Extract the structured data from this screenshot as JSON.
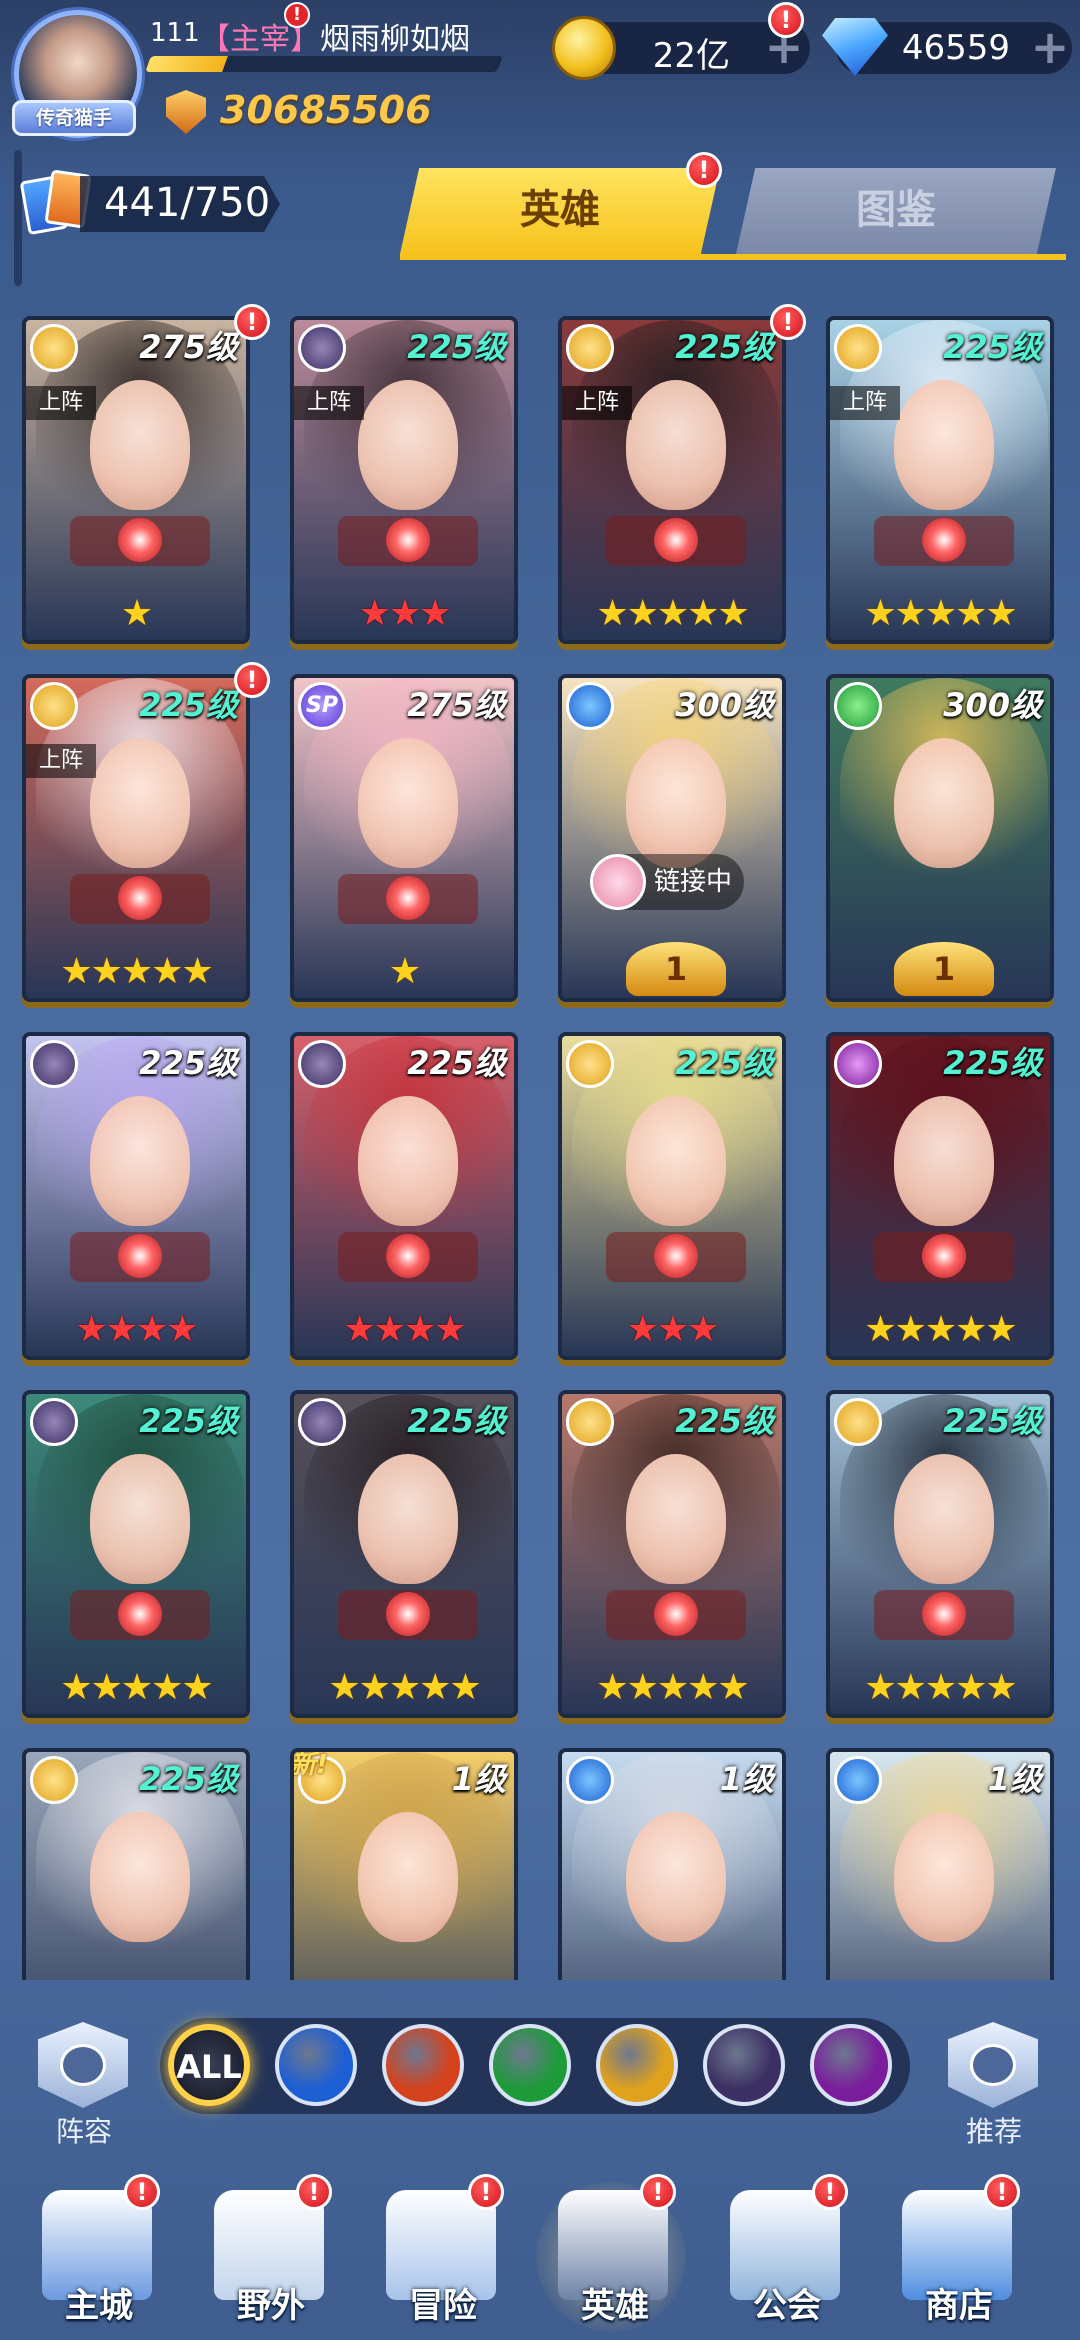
{
  "player": {
    "level": "111",
    "name_tag": "【主宰】",
    "name": "烟雨柳如烟",
    "title_badge": "传奇猫手",
    "power": "30685506",
    "exp_fraction": 0.22
  },
  "currencies": {
    "gold": "22亿",
    "gems": "46559",
    "plus_symbol": "+",
    "alert": "!"
  },
  "roster": {
    "count": "441/750"
  },
  "tabs": {
    "hero": "英雄",
    "atlas": "图鉴"
  },
  "labels": {
    "on_team": "上阵",
    "linking": "链接中",
    "new": "新!"
  },
  "heroes": [
    {
      "element": "light",
      "level": "275级",
      "level_color": "white",
      "on_team": true,
      "stars": "★",
      "star_style": "gold-wing",
      "alert": true,
      "hair": "#2c2422"
    },
    {
      "element": "dark",
      "level": "225级",
      "level_color": "teal",
      "on_team": true,
      "stars": "★★★",
      "star_style": "red",
      "alert": false,
      "hair": "#3a2b32"
    },
    {
      "element": "light",
      "level": "225级",
      "level_color": "teal",
      "on_team": true,
      "stars": "★★★★★",
      "star_style": "gold",
      "alert": true,
      "hair": "#1f1c1e"
    },
    {
      "element": "light",
      "level": "225级",
      "level_color": "teal",
      "on_team": true,
      "stars": "★★★★★",
      "star_style": "gold",
      "alert": false,
      "hair": "#e6f0fb"
    },
    {
      "element": "light",
      "level": "225级",
      "level_color": "teal",
      "on_team": true,
      "stars": "★★★★★",
      "star_style": "gold",
      "alert": true,
      "hair": "#efe9f1"
    },
    {
      "element": "sp",
      "element_text": "SP",
      "level": "275级",
      "level_color": "white",
      "on_team": false,
      "stars": "★",
      "star_style": "gold-wing",
      "alert": false,
      "hair": "#f4b6c4"
    },
    {
      "element": "water",
      "level": "300级",
      "level_color": "white",
      "on_team": false,
      "rank": "1",
      "linking": true,
      "alert": false,
      "hair": "#f5d37a"
    },
    {
      "element": "wind",
      "level": "300级",
      "level_color": "white",
      "on_team": false,
      "rank": "1",
      "alert": false,
      "hair": "#e8c25a"
    },
    {
      "element": "dark",
      "level": "225级",
      "level_color": "white",
      "on_team": false,
      "stars": "★★★★",
      "star_style": "red",
      "alert": false,
      "hair": "#b7a6ee"
    },
    {
      "element": "dark",
      "level": "225级",
      "level_color": "white",
      "on_team": false,
      "stars": "★★★★",
      "star_style": "red",
      "alert": false,
      "hair": "#c4303a"
    },
    {
      "element": "light",
      "level": "225级",
      "level_color": "teal",
      "on_team": false,
      "stars": "★★★",
      "star_style": "red",
      "alert": false,
      "hair": "#e6dc8c"
    },
    {
      "element": "chaos",
      "level": "225级",
      "level_color": "teal",
      "on_team": false,
      "stars": "★★★★★",
      "star_style": "gold",
      "alert": false,
      "hair": "#5a0f1a"
    },
    {
      "element": "dark",
      "level": "225级",
      "level_color": "teal",
      "on_team": false,
      "stars": "★★★★★",
      "star_style": "gold",
      "alert": false,
      "hair": "#1e4a3a"
    },
    {
      "element": "dark",
      "level": "225级",
      "level_color": "teal",
      "on_team": false,
      "stars": "★★★★★",
      "star_style": "gold",
      "alert": false,
      "hair": "#241c20"
    },
    {
      "element": "light",
      "level": "225级",
      "level_color": "teal",
      "on_team": false,
      "stars": "★★★★★",
      "star_style": "gold",
      "alert": false,
      "hair": "#3a2420"
    },
    {
      "element": "light",
      "level": "225级",
      "level_color": "teal",
      "on_team": false,
      "stars": "★★★★★",
      "star_style": "gold",
      "alert": false,
      "hair": "#1c2430"
    },
    {
      "element": "light",
      "level": "225级",
      "level_color": "teal",
      "on_team": false,
      "alert": false,
      "hair": "#e8e8ee"
    },
    {
      "element": "light",
      "level": "1级",
      "level_color": "white",
      "on_team": false,
      "is_new": true,
      "alert": false,
      "hair": "#d0a24a"
    },
    {
      "element": "water",
      "level": "1级",
      "level_color": "white",
      "on_team": false,
      "alert": false,
      "hair": "#d8dde8"
    },
    {
      "element": "water",
      "level": "1级",
      "level_color": "white",
      "on_team": false,
      "alert": false,
      "hair": "#f0d896"
    }
  ],
  "filters": {
    "left_label": "阵容",
    "right_label": "推荐",
    "options": [
      {
        "name": "all",
        "text": "ALL",
        "color": "#12151f"
      },
      {
        "name": "water",
        "text": "",
        "color": "#1c5fd3"
      },
      {
        "name": "fire",
        "text": "",
        "color": "#d6421d"
      },
      {
        "name": "wind",
        "text": "",
        "color": "#1d9b39"
      },
      {
        "name": "light",
        "text": "",
        "color": "#e0a21c"
      },
      {
        "name": "dark",
        "text": "",
        "color": "#3c2f63"
      },
      {
        "name": "chaos",
        "text": "",
        "color": "#7a1c9b"
      }
    ]
  },
  "nav": [
    {
      "name": "main-city",
      "label": "主城",
      "color": "#6d9be0",
      "alert": true
    },
    {
      "name": "wild",
      "label": "野外",
      "color": "#c2d4ec",
      "alert": true
    },
    {
      "name": "adventure",
      "label": "冒险",
      "color": "#a8c3ea",
      "alert": true
    },
    {
      "name": "hero",
      "label": "英雄",
      "color": "#6f83a8",
      "alert": true,
      "active": true
    },
    {
      "name": "guild",
      "label": "公会",
      "color": "#8fb3dc",
      "alert": true
    },
    {
      "name": "shop",
      "label": "商店",
      "color": "#4f8ee0",
      "alert": true
    }
  ]
}
